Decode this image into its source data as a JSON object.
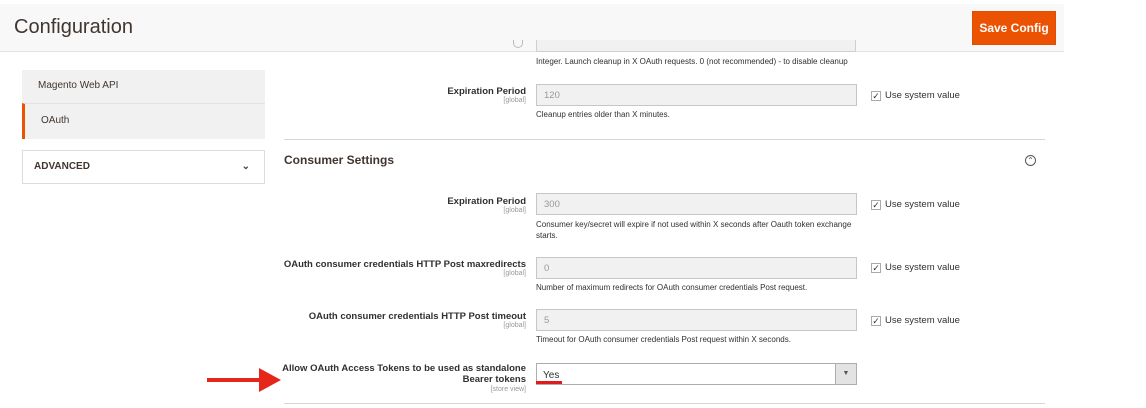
{
  "header": {
    "title": "Configuration",
    "save_label": "Save Config"
  },
  "sidebar": {
    "items": [
      {
        "label": "Magento Web API"
      },
      {
        "label": "OAuth"
      }
    ],
    "advanced_label": "ADVANCED",
    "advanced_icon": "chevron-down-icon"
  },
  "cleanup": {
    "prev_note": "Integer. Launch cleanup in X OAuth requests. 0 (not recommended) - to disable cleanup",
    "expiration_label": "Expiration Period",
    "expiration_scope": "[global]",
    "expiration_value": "120",
    "expiration_note": "Cleanup entries older than X minutes.",
    "use_system_label": "Use system value"
  },
  "consumer": {
    "section_title": "Consumer Settings",
    "collapse_icon": "collapse-circle-icon",
    "fields": [
      {
        "label": "Expiration Period",
        "scope": "[global]",
        "value": "300",
        "note_line1": "Consumer key/secret will expire if not used within X seconds after Oauth token exchange",
        "note_line2": "starts.",
        "use_system_label": "Use system value"
      },
      {
        "label": "OAuth consumer credentials HTTP Post maxredirects",
        "scope": "[global]",
        "value": "0",
        "note": "Number of maximum redirects for OAuth consumer credentials Post request.",
        "use_system_label": "Use system value"
      },
      {
        "label": "OAuth consumer credentials HTTP Post timeout",
        "scope": "[global]",
        "value": "5",
        "note": "Timeout for OAuth consumer credentials Post request within X seconds.",
        "use_system_label": "Use system value"
      }
    ],
    "bearer": {
      "label_line1": "Allow OAuth Access Tokens to be used as standalone",
      "label_line2": "Bearer tokens",
      "scope": "[store view]",
      "selected": "Yes"
    }
  },
  "colors": {
    "accent": "#eb5202",
    "annotation_red": "#e5271a"
  }
}
